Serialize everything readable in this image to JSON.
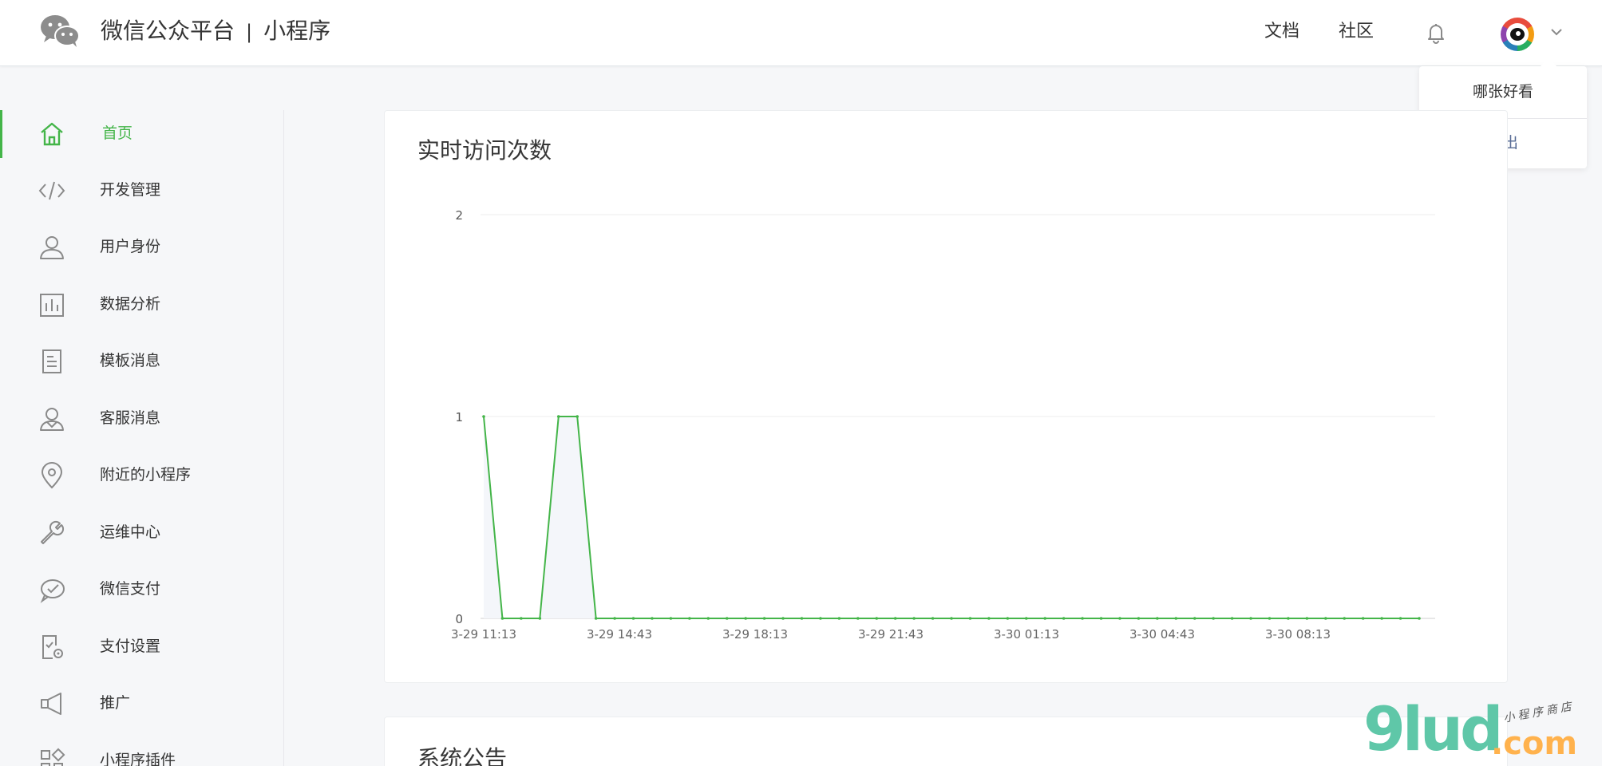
{
  "header": {
    "platform_name": "微信公众平台",
    "separator": "|",
    "product_name": "小程序",
    "links": [
      "文档",
      "社区"
    ]
  },
  "user_menu": {
    "account_name": "哪张好看",
    "logout_label": "退出"
  },
  "sidebar": {
    "items": [
      {
        "label": "首页",
        "icon": "home-icon",
        "active": true
      },
      {
        "label": "开发管理",
        "icon": "code-icon"
      },
      {
        "label": "用户身份",
        "icon": "user-icon"
      },
      {
        "label": "数据分析",
        "icon": "bar-chart-icon"
      },
      {
        "label": "模板消息",
        "icon": "document-icon"
      },
      {
        "label": "客服消息",
        "icon": "service-user-icon"
      },
      {
        "label": "附近的小程序",
        "icon": "location-pin-icon"
      },
      {
        "label": "运维中心",
        "icon": "wrench-icon"
      },
      {
        "label": "微信支付",
        "icon": "wechat-pay-icon"
      },
      {
        "label": "支付设置",
        "icon": "payment-settings-icon"
      },
      {
        "label": "推广",
        "icon": "megaphone-icon"
      },
      {
        "label": "小程序插件",
        "icon": "plugin-icon"
      }
    ]
  },
  "main": {
    "realtime_title": "实时访问次数",
    "announcement_title": "系统公告"
  },
  "colors": {
    "accent": "#44b549",
    "link_blue": "#576b95",
    "text": "#353535"
  },
  "watermark": {
    "brand": "9lud",
    "suffix": ".com",
    "tagline": "小程序商店"
  },
  "chart_data": {
    "type": "line",
    "title": "实时访问次数",
    "x_tick_labels": [
      "3-29 11:13",
      "3-29 14:43",
      "3-29 18:13",
      "3-29 21:43",
      "3-30 01:13",
      "3-30 04:43",
      "3-30 08:13"
    ],
    "yticks": [
      0,
      1,
      2
    ],
    "ylim": [
      0,
      2
    ],
    "grid": true,
    "series": [
      {
        "values": [
          1,
          0,
          0,
          0,
          1,
          1,
          0,
          0,
          0,
          0,
          0,
          0,
          0,
          0,
          0,
          0,
          0,
          0,
          0,
          0,
          0,
          0,
          0,
          0,
          0,
          0,
          0,
          0,
          0,
          0,
          0,
          0,
          0,
          0,
          0,
          0,
          0,
          0,
          0,
          0,
          0,
          0,
          0,
          0,
          0,
          0,
          0,
          0,
          0,
          0,
          0
        ]
      }
    ]
  }
}
